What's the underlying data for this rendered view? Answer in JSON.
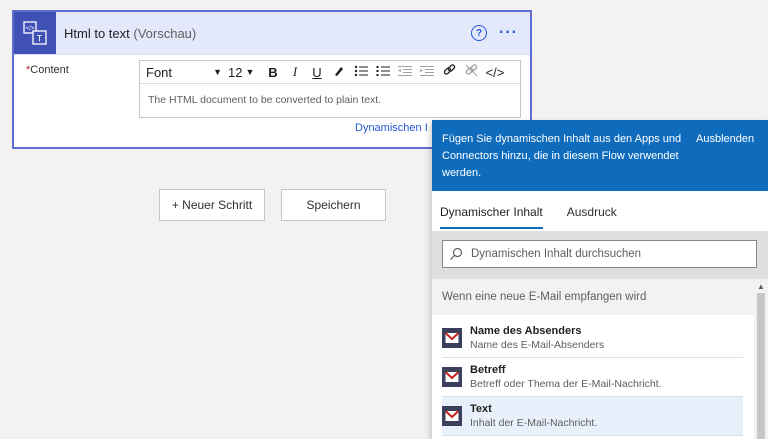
{
  "card": {
    "title": "Html to text",
    "title_suffix": "(Vorschau)",
    "content_required_mark": "*",
    "content_label": "Content",
    "font_select": "Font",
    "font_size": "12",
    "editor_placeholder": "The HTML document to be converted to plain text.",
    "dynamic_link": "Dynamischen I"
  },
  "toolbar": {
    "bold": "B",
    "italic": "I",
    "underline": "U",
    "code": "</>"
  },
  "steps": {
    "new_step": "+ Neuer Schritt",
    "save": "Speichern"
  },
  "panel": {
    "header_text": "Fügen Sie dynamischen Inhalt aus den Apps und Connectors hinzu, die in diesem Flow verwendet werden.",
    "hide": "Ausblenden",
    "tabs": [
      "Dynamischer Inhalt",
      "Ausdruck"
    ],
    "search_placeholder": "Dynamischen Inhalt durchsuchen",
    "group_title": "Wenn eine neue E-Mail empfangen wird",
    "items": [
      {
        "title": "Name des Absenders",
        "desc": "Name des E-Mail-Absenders"
      },
      {
        "title": "Betreff",
        "desc": "Betreff oder Thema der E-Mail-Nachricht."
      },
      {
        "title": "Text",
        "desc": "Inhalt der E-Mail-Nachricht."
      }
    ]
  },
  "colors": {
    "accent": "#0f6cbd",
    "card_header": "#e4e8fb",
    "action_icon": "#3f51b5"
  }
}
